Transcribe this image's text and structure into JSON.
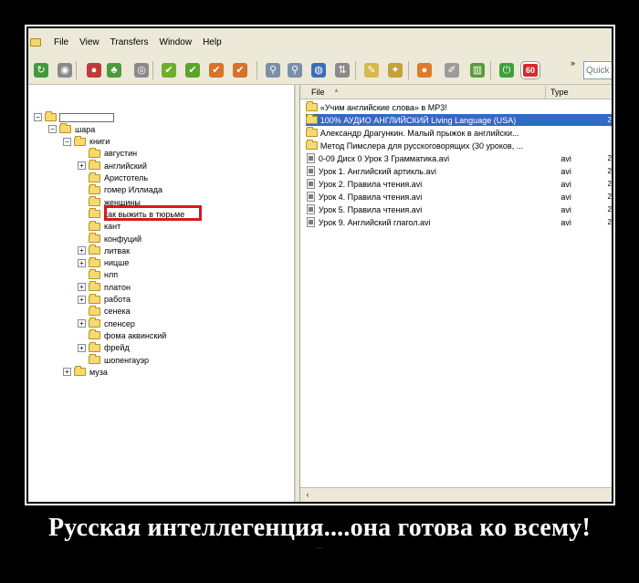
{
  "menu": {
    "items": [
      "File",
      "View",
      "Transfers",
      "Window",
      "Help"
    ]
  },
  "toolbar": {
    "icons": [
      {
        "name": "refresh-icon",
        "color": "#3f9a3f",
        "glyph": "↻"
      },
      {
        "name": "connect-icon",
        "color": "#8a8a8a",
        "glyph": "◉"
      },
      {
        "name": "disconnect-icon",
        "color": "#c03a3a",
        "glyph": "●"
      },
      {
        "name": "users-icon",
        "color": "#4d9a3a",
        "glyph": "♣"
      },
      {
        "name": "search-users-icon",
        "color": "#8a8a8a",
        "glyph": "◎"
      },
      {
        "name": "download-icon",
        "color": "#6fae2a",
        "glyph": "✔"
      },
      {
        "name": "download-queue-icon",
        "color": "#5aa52a",
        "glyph": "✔"
      },
      {
        "name": "upload-icon",
        "color": "#d6742a",
        "glyph": "✔"
      },
      {
        "name": "upload-queue-icon",
        "color": "#d6742a",
        "glyph": "✔"
      },
      {
        "name": "search-icon",
        "color": "#7a8fa8",
        "glyph": "⚲"
      },
      {
        "name": "search-advanced-icon",
        "color": "#7a8fa8",
        "glyph": "⚲"
      },
      {
        "name": "network-icon",
        "color": "#3a6fb8",
        "glyph": "◍"
      },
      {
        "name": "transfer-icon",
        "color": "#8a8a8a",
        "glyph": "⇅"
      },
      {
        "name": "notes-icon",
        "color": "#d7b84a",
        "glyph": "✎"
      },
      {
        "name": "favorites-icon",
        "color": "#c4a03a",
        "glyph": "✦"
      },
      {
        "name": "chat-icon",
        "color": "#e07a28",
        "glyph": "●"
      },
      {
        "name": "edit-icon",
        "color": "#9a9a9a",
        "glyph": "✐"
      },
      {
        "name": "stats-icon",
        "color": "#5a9a3a",
        "glyph": "▥"
      },
      {
        "name": "power-icon",
        "color": "#3aa23a",
        "glyph": "⏻"
      },
      {
        "name": "limit-badge-icon",
        "color": "#d62a2a",
        "glyph": "60"
      }
    ],
    "more_label": "»",
    "quick_placeholder": "Quick"
  },
  "tree": [
    {
      "label": "",
      "exp": "−",
      "indent": 0,
      "boxed": true
    },
    {
      "label": "шара",
      "exp": "−",
      "indent": 1
    },
    {
      "label": "книги",
      "exp": "−",
      "indent": 2
    },
    {
      "label": "августин",
      "exp": "",
      "indent": 3
    },
    {
      "label": "английский",
      "exp": "+",
      "indent": 3
    },
    {
      "label": "Аристотель",
      "exp": "",
      "indent": 3
    },
    {
      "label": "гомер Иллиада",
      "exp": "",
      "indent": 3
    },
    {
      "label": "женщины",
      "exp": "",
      "indent": 3
    },
    {
      "label": "как выжить в тюрьме",
      "exp": "",
      "indent": 3,
      "highlighted": true
    },
    {
      "label": "кант",
      "exp": "",
      "indent": 3
    },
    {
      "label": "конфуций",
      "exp": "",
      "indent": 3
    },
    {
      "label": "литвак",
      "exp": "+",
      "indent": 3
    },
    {
      "label": "ницше",
      "exp": "+",
      "indent": 3
    },
    {
      "label": "нлп",
      "exp": "",
      "indent": 3
    },
    {
      "label": "платон",
      "exp": "+",
      "indent": 3
    },
    {
      "label": "работа",
      "exp": "+",
      "indent": 3
    },
    {
      "label": "сенека",
      "exp": "",
      "indent": 3
    },
    {
      "label": "спенсер",
      "exp": "+",
      "indent": 3
    },
    {
      "label": "фома аквинский",
      "exp": "",
      "indent": 3
    },
    {
      "label": "фрейд",
      "exp": "+",
      "indent": 3
    },
    {
      "label": "шопенгауэр",
      "exp": "",
      "indent": 3
    },
    {
      "label": "муза",
      "exp": "+",
      "indent": 2
    }
  ],
  "file_list": {
    "headers": {
      "file": "File",
      "sort_glyph": "▲",
      "type": "Type"
    },
    "rows": [
      {
        "name": "«Учим английские слова» в MP3!",
        "type": "",
        "kind": "folder"
      },
      {
        "name": "100% АУДИО АНГЛИЙСКИЙ Living Language (USA)",
        "type": "",
        "kind": "folder",
        "selected": true,
        "extra": "2"
      },
      {
        "name": "Александр Драгункин. Малый прыжок в английски...",
        "type": "",
        "kind": "folder"
      },
      {
        "name": "Метод Пимслера для русскоговорящих (30 уроков, ...",
        "type": "",
        "kind": "folder"
      },
      {
        "name": "0-09 Диск 0 Урок 3 Грамматика.avi",
        "type": "avi",
        "kind": "file",
        "extra": "2"
      },
      {
        "name": "Урок 1. Английский артикль.avi",
        "type": "avi",
        "kind": "file",
        "extra": "2"
      },
      {
        "name": "Урок 2. Правила чтения.avi",
        "type": "avi",
        "kind": "file",
        "extra": "2"
      },
      {
        "name": "Урок 4. Правила чтения.avi",
        "type": "avi",
        "kind": "file",
        "extra": "2"
      },
      {
        "name": "Урок 5. Правила чтения.avi",
        "type": "avi",
        "kind": "file",
        "extra": "2"
      },
      {
        "name": "Урок 9. Английский глагол.avi",
        "type": "avi",
        "kind": "file",
        "extra": "2"
      }
    ],
    "scroll_arrow": "‹"
  },
  "caption": "Русская интеллегенция....она готова ко всему!",
  "watermark": "..."
}
